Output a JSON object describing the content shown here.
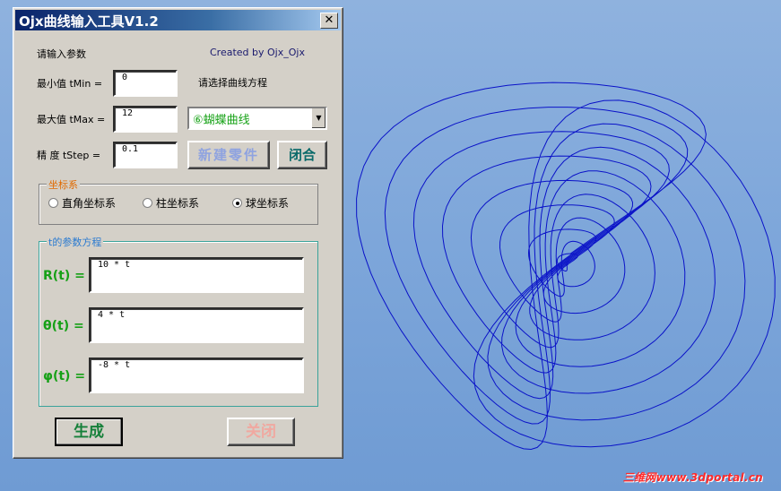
{
  "window": {
    "title": "Ojx曲线输入工具V1.2",
    "close_glyph": "✕"
  },
  "header": {
    "prompt": "请输入参数",
    "credit": "Created by Ojx_Ojx"
  },
  "params": {
    "tmin_label": "最小值 tMin =",
    "tmin_value": "0",
    "tmax_label": "最大值 tMax =",
    "tmax_value": "12",
    "tstep_label": "精 度 tStep =",
    "tstep_value": "0.1"
  },
  "equation_select": {
    "label": "请选择曲线方程",
    "selected": "⑥蝴蝶曲线"
  },
  "buttons": {
    "new_part": "新建零件",
    "close_small": "闭合",
    "generate": "生成",
    "close": "关闭"
  },
  "coord_system": {
    "title": "坐标系",
    "options": [
      {
        "label": "直角坐标系",
        "selected": false
      },
      {
        "label": "柱坐标系",
        "selected": false
      },
      {
        "label": "球坐标系",
        "selected": true
      }
    ]
  },
  "equations": {
    "title": "t的参数方程",
    "rows": [
      {
        "label": "R(t) =",
        "value": "10 * t"
      },
      {
        "label": "θ(t) =",
        "value": "4 * t"
      },
      {
        "label": "φ(t) =",
        "value": "-8 * t"
      }
    ]
  },
  "watermark": "三维网www.3dportal.cn",
  "colors": {
    "curve": "#0a12c8",
    "accent_green": "#16a016",
    "title_bar": "#0a246a"
  }
}
